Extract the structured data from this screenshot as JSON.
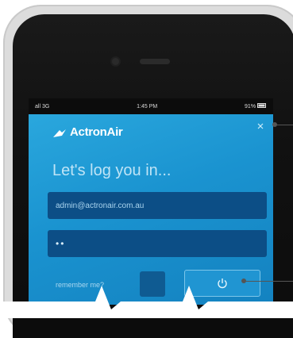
{
  "status_bar": {
    "carrier": "all 3G",
    "time": "1:45 PM",
    "battery": "91%"
  },
  "brand": {
    "name": "ActronAir"
  },
  "login": {
    "title": "Let's log you in...",
    "email_value": "admin@actronair.com.au",
    "password_value": "••",
    "remember_label": "remember me?"
  },
  "colors": {
    "app_blue": "#1a93d0",
    "field_blue": "#0c4e86",
    "phone_frame": "#dcdcdc"
  }
}
